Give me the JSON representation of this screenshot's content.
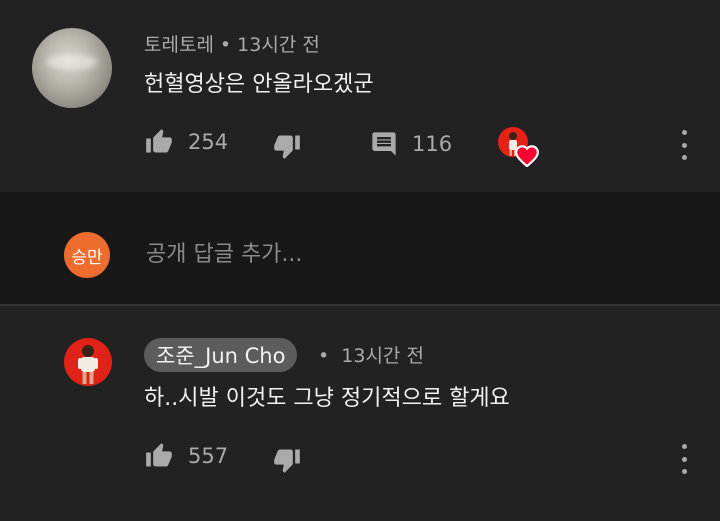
{
  "comment1": {
    "author": "토레토레",
    "separator": "•",
    "time": "13시간 전",
    "text": "헌혈영상은 안올라오겠군",
    "likes": "254",
    "replies": "116",
    "icons": {
      "like": "thumb-up-icon",
      "dislike": "thumb-down-icon",
      "reply": "comment-icon",
      "more": "more-vert-icon",
      "creator_heart": "creator-heart-icon"
    }
  },
  "reply_box": {
    "avatar_text": "승만",
    "avatar_color": "#ef6c2f",
    "placeholder": "공개 답글 추가..."
  },
  "comment2": {
    "author": "조준_Jun Cho",
    "separator": "•",
    "time": "13시간 전",
    "text": "하..시발 이것도 그냥 정기적으로 할게요",
    "likes": "557",
    "icons": {
      "like": "thumb-up-icon",
      "dislike": "thumb-down-icon",
      "more": "more-vert-icon"
    }
  },
  "colors": {
    "background": "#181818",
    "comment_bg": "#222222",
    "text": "#f1f1f1",
    "secondary_text": "#aaaaaa",
    "heart": "#ff0033",
    "channel_red": "#e02319"
  }
}
